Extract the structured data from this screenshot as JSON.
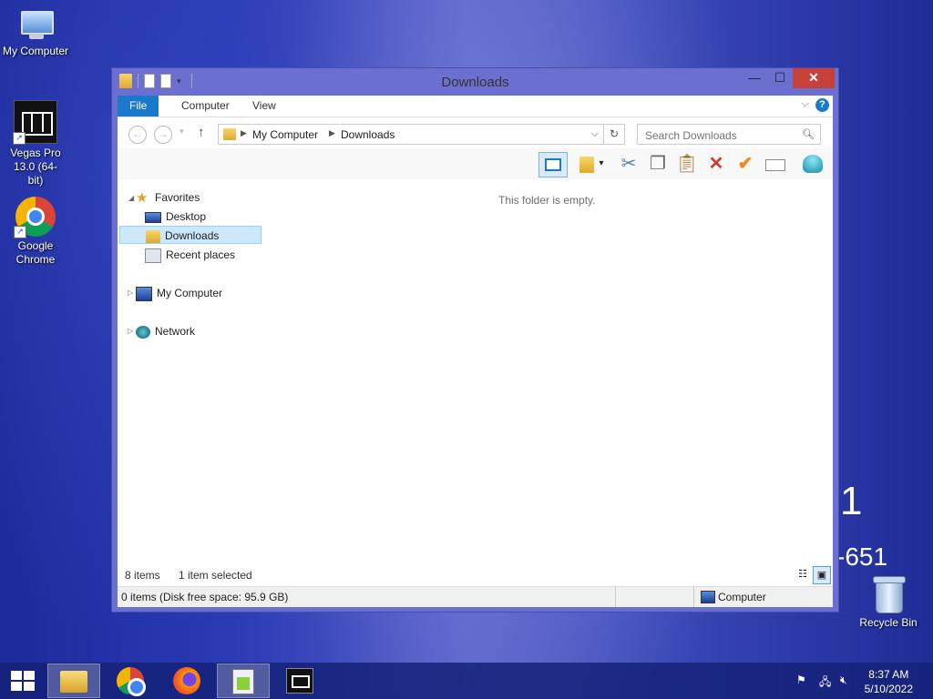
{
  "desktop": {
    "icons": [
      {
        "label": "My Computer",
        "icon": "computer-icon"
      },
      {
        "label": "Vegas Pro 13.0 (64-bit)",
        "icon": "vegas-pro-icon"
      },
      {
        "label": "Google Chrome",
        "icon": "chrome-icon"
      },
      {
        "label": "Recycle Bin",
        "icon": "recycle-bin-icon"
      }
    ],
    "wallpaper_text": [
      "1",
      "-651"
    ]
  },
  "window": {
    "title": "Downloads",
    "controls": {
      "minimize": "—",
      "maximize": "☐",
      "close": "✕"
    },
    "ribbon_tabs": [
      "File",
      "Computer",
      "View"
    ],
    "address": {
      "crumbs": [
        "My Computer",
        "Downloads"
      ]
    },
    "search": {
      "placeholder": "Search Downloads"
    },
    "nav": {
      "favorites": "Favorites",
      "desktop": "Desktop",
      "downloads": "Downloads",
      "recent": "Recent places",
      "computer": "My Computer",
      "network": "Network"
    },
    "empty_message": "This folder is empty.",
    "status": {
      "items": "8 items",
      "selected": "1 item selected"
    },
    "statusbar": {
      "free_space": "0 items (Disk free space: 95.9 GB)",
      "location": "Computer"
    }
  },
  "taskbar": {
    "apps": [
      "file-explorer-icon",
      "chrome-icon",
      "firefox-icon",
      "notepad-plus-icon",
      "vegas-pro-icon"
    ],
    "clock": {
      "time": "8:37 AM",
      "date": "5/10/2022"
    }
  },
  "colors": {
    "accent": "#1979ca",
    "close": "#c7403a",
    "selection": "#cce8ff"
  }
}
